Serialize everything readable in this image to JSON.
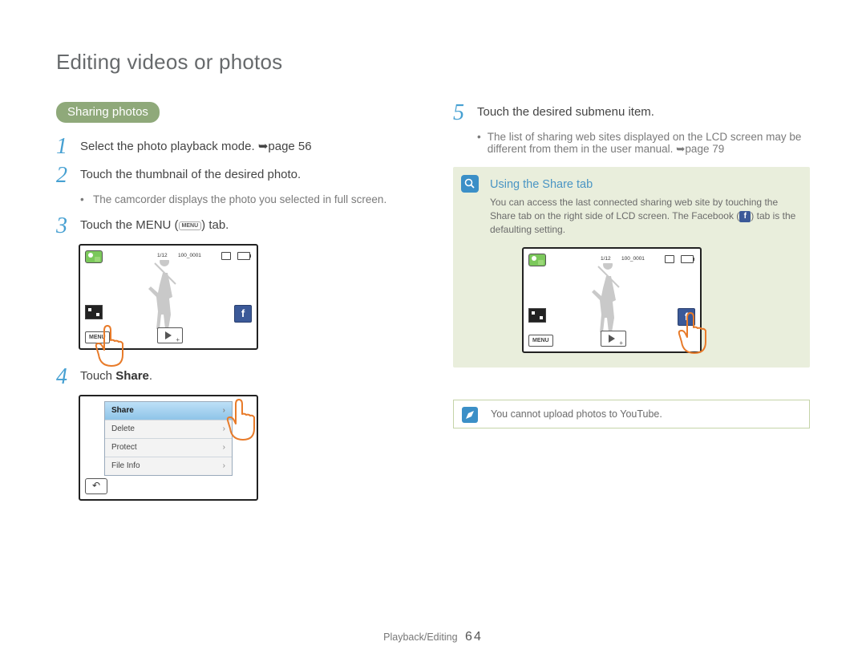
{
  "page": {
    "title": "Editing videos or photos",
    "section_pill": "Sharing photos",
    "footer_section": "Playback/Editing",
    "footer_page": "64"
  },
  "steps": {
    "s1_num": "1",
    "s1_a": "Select the photo playback mode. ",
    "s1_b": "page 56",
    "s2_num": "2",
    "s2": "Touch the thumbnail of the desired photo.",
    "s2_bullet": "The camcorder displays the photo you selected in full screen.",
    "s3_num": "3",
    "s3_a": "Touch the MENU (",
    "s3_b": ") tab.",
    "s3_btn": "MENU",
    "s4_num": "4",
    "s4_a": "Touch ",
    "s4_b": "Share",
    "s4_c": ".",
    "s5_num": "5",
    "s5": "Touch the desired submenu item.",
    "s5_bullet_a": "The list of sharing web sites displayed on the LCD screen may be different from them in the user manual. ",
    "s5_bullet_b": "page 79"
  },
  "lcd": {
    "count": "1/12",
    "fname": "100_0001",
    "menu_label": "MENU"
  },
  "menu": {
    "items": [
      "Share",
      "Delete",
      "Protect",
      "File Info"
    ],
    "selected": 0
  },
  "info": {
    "title": "Using the Share tab",
    "body_a": "You can access the last connected sharing web site by touching the Share tab on the right side of LCD screen. The Facebook (",
    "body_b": ") tab is the defaulting setting."
  },
  "note": {
    "text": "You cannot upload photos to YouTube."
  }
}
